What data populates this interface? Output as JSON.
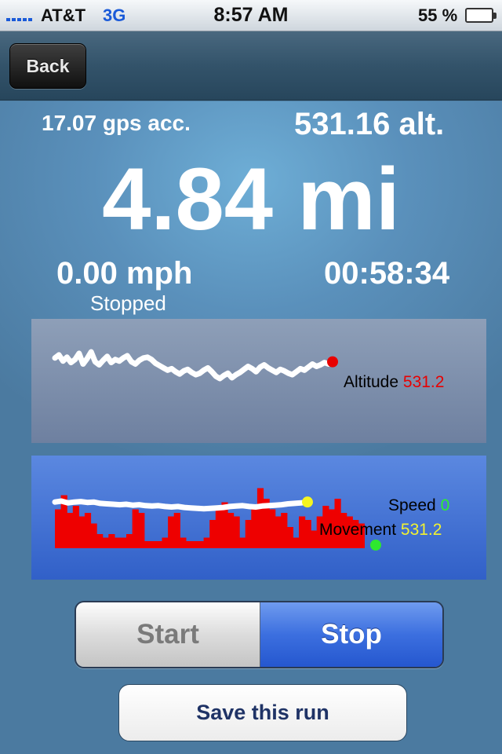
{
  "status_bar": {
    "carrier": "AT&T",
    "network": "3G",
    "time": "8:57 AM",
    "battery_percent": "55 %",
    "battery_level": 0.55
  },
  "nav": {
    "back_label": "Back"
  },
  "stats": {
    "gps_accuracy": "17.07 gps acc.",
    "altitude": "531.16 alt.",
    "distance": "4.84 mi",
    "speed": "0.00 mph",
    "elapsed": "00:58:34",
    "status": "Stopped"
  },
  "altitude_graph": {
    "label": "Altitude",
    "value": "531.2",
    "line_color": "#ffffff",
    "marker_color": "#e80000",
    "points": [
      2.0,
      1.6,
      2.4,
      1.9,
      2.6,
      2.2,
      1.4,
      2.8,
      2.1,
      1.2,
      2.5,
      2.9,
      2.3,
      1.8,
      2.6,
      2.2,
      2.4,
      2.0,
      1.7,
      2.5,
      2.8,
      2.3,
      2.0,
      1.9,
      2.2,
      2.7,
      3.0,
      3.3,
      3.6,
      3.4,
      3.8,
      4.1,
      3.7,
      3.5,
      3.9,
      4.2,
      4.0,
      3.6,
      3.3,
      3.8,
      4.4,
      4.7,
      4.3,
      4.0,
      4.6,
      4.2,
      3.9,
      3.5,
      3.1,
      3.4,
      3.8,
      3.2,
      2.9,
      3.3,
      3.6,
      3.9,
      3.5,
      3.7,
      4.0,
      4.2,
      3.8,
      3.4,
      3.6,
      3.2,
      2.8,
      3.1,
      2.9,
      2.6,
      2.8,
      2.5
    ]
  },
  "speed_graph": {
    "speed_label": "Speed",
    "speed_value": "0",
    "movement_label": "Movement",
    "movement_value": "531.2",
    "bar_color": "#ee0000",
    "line_color": "#ffffff",
    "speed_marker_color": "#2ee82e",
    "movement_marker_color": "#f5f520",
    "bars": [
      0.55,
      0.75,
      0.5,
      0.6,
      0.45,
      0.5,
      0.35,
      0.2,
      0.15,
      0.2,
      0.15,
      0.15,
      0.2,
      0.55,
      0.5,
      0.1,
      0.1,
      0.1,
      0.15,
      0.45,
      0.5,
      0.15,
      0.1,
      0.1,
      0.1,
      0.15,
      0.4,
      0.55,
      0.65,
      0.5,
      0.45,
      0.15,
      0.4,
      0.6,
      0.85,
      0.7,
      0.55,
      0.45,
      0.5,
      0.3,
      0.15,
      0.45,
      0.4,
      0.25,
      0.45,
      0.6,
      0.55,
      0.7,
      0.5,
      0.45,
      0.4,
      0.35,
      0.0
    ],
    "movement": [
      0.5,
      0.52,
      0.48,
      0.5,
      0.51,
      0.49,
      0.5,
      0.47,
      0.46,
      0.45,
      0.44,
      0.45,
      0.43,
      0.44,
      0.42,
      0.41,
      0.42,
      0.4,
      0.39,
      0.4,
      0.38,
      0.37,
      0.36,
      0.35,
      0.36,
      0.37,
      0.38,
      0.4,
      0.41,
      0.42,
      0.4,
      0.39,
      0.41,
      0.42,
      0.43,
      0.44,
      0.46,
      0.47,
      0.48,
      0.5
    ]
  },
  "controls": {
    "start_label": "Start",
    "stop_label": "Stop",
    "save_label": "Save this run"
  }
}
